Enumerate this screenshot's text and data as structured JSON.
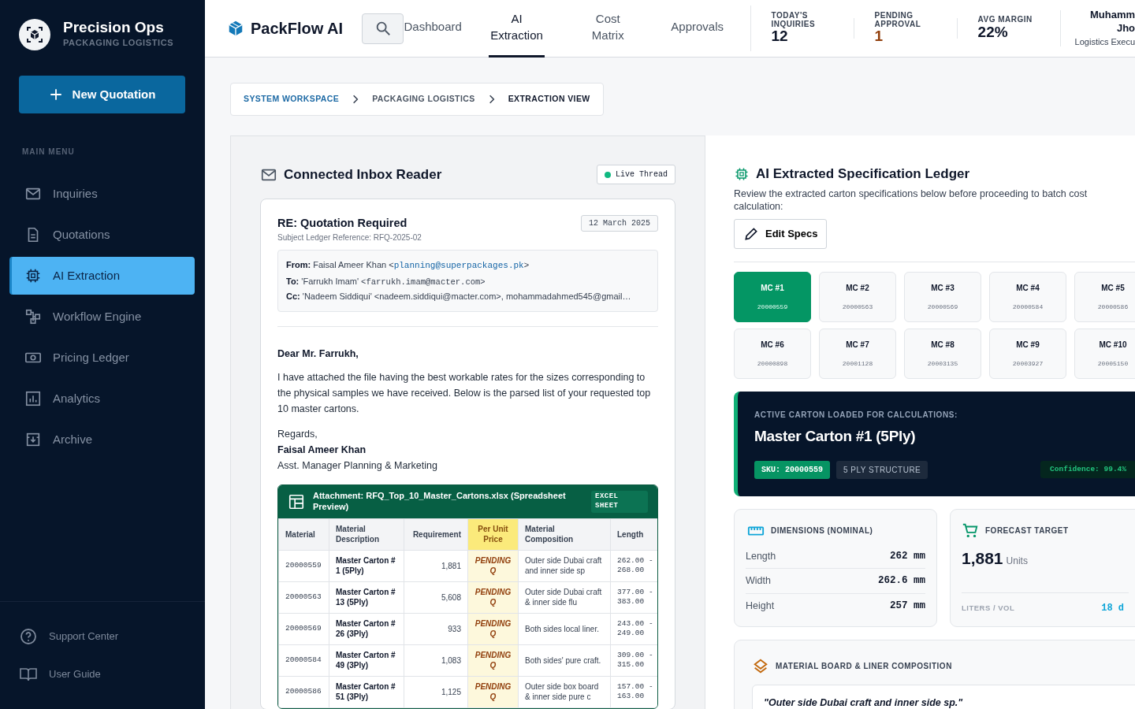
{
  "brand": {
    "title": "Precision Ops",
    "subtitle": "PACKAGING LOGISTICS"
  },
  "new_button": {
    "label": "New Quotation"
  },
  "menu_heading": "MAIN MENU",
  "sidebar": {
    "items": [
      {
        "label": "Inquiries",
        "selected": false
      },
      {
        "label": "Quotations",
        "selected": false
      },
      {
        "label": "AI Extraction",
        "selected": true
      },
      {
        "label": "Workflow Engine",
        "selected": false
      },
      {
        "label": "Pricing Ledger",
        "selected": false
      },
      {
        "label": "Analytics",
        "selected": false
      },
      {
        "label": "Archive",
        "selected": false
      }
    ],
    "footer": [
      {
        "label": "Support Center"
      },
      {
        "label": "User Guide"
      }
    ]
  },
  "header": {
    "app_title": "PackFlow AI",
    "tabs": [
      {
        "label": "Dashboard",
        "selected": false
      },
      {
        "label": "AI Extraction",
        "selected": true
      },
      {
        "label": "Cost Matrix",
        "selected": false
      },
      {
        "label": "Approvals",
        "selected": false
      }
    ],
    "stats": [
      {
        "label": "TODAY'S INQUIRIES",
        "value": "12",
        "color": "#0f172a"
      },
      {
        "label": "PENDING APPROVAL",
        "value": "1",
        "color": "#92400e"
      },
      {
        "label": "AVG MARGIN",
        "value": "22%",
        "color": "#0f172a"
      }
    ],
    "user": {
      "name": "Muhamm Jho",
      "role": "Logistics Execu"
    }
  },
  "breadcrumb": [
    {
      "label": "SYSTEM WORKSPACE",
      "selected": false
    },
    {
      "label": "PACKAGING LOGISTICS",
      "selected": false
    },
    {
      "label": "EXTRACTION VIEW",
      "selected": true
    }
  ],
  "inbox": {
    "title": "Connected Inbox Reader",
    "badge": "Live Thread",
    "email": {
      "subject": "RE: Quotation Required",
      "reference": "Subject Ledger Reference: RFQ-2025-02",
      "date": "12 March 2025",
      "headers": [
        {
          "label": "From:",
          "text": "Faisal Ameer Khan <",
          "email": "planning@superpackages.pk",
          "after": ">",
          "kind": "link"
        },
        {
          "label": "To:",
          "text": "'Farrukh Imam' ",
          "email": "<farrukh.imam@macter.com>",
          "kind": "mono"
        },
        {
          "label": "Cc:",
          "text": "'Nadeem Siddiqui' <nadeem.siddiqui@macter.com>, mohammadahmed545@gmail…",
          "kind": "plain"
        }
      ],
      "greeting": "Dear Mr. Farrukh,",
      "body": "I have attached the file having the best workable rates for the sizes corresponding to the physical samples we have received. Below is the parsed list of your requested top 10 master cartons.",
      "closing": "Regards,",
      "signer": "Faisal Ameer Khan",
      "signer_title": "Asst. Manager Planning & Marketing"
    },
    "attachment": {
      "title": "Attachment: RFQ_Top_10_Master_Cartons.xlsx (Spreadsheet Preview)",
      "badge": "EXCEL SHEET",
      "table": {
        "columns": [
          "Material",
          "Material Description",
          "Requirement",
          "Per Unit Price",
          "Material Composition",
          "Length"
        ],
        "rows": [
          [
            "20000559",
            "Master Carton # 1 (5Ply)",
            "1,881",
            "PENDING Q",
            "Outer side Dubai craft and inner side sp",
            "262.00 - 268.00"
          ],
          [
            "20000563",
            "Master Carton # 13 (5Ply)",
            "5,608",
            "PENDING Q",
            "Outer side Dubai craft & inner side flu",
            "377.00 - 383.00"
          ],
          [
            "20000569",
            "Master Carton # 26 (3Ply)",
            "933",
            "PENDING Q",
            "Both sides local liner.",
            "243.00 - 249.00"
          ],
          [
            "20000584",
            "Master Carton # 49 (3Ply)",
            "1,083",
            "PENDING Q",
            "Both sides' pure craft.",
            "309.00 - 315.00"
          ],
          [
            "20000586",
            "Master Carton # 51 (3Ply)",
            "1,125",
            "PENDING Q",
            "Outer side box board & inner side pure c",
            "157.00 - 163.00"
          ]
        ]
      }
    }
  },
  "ledger": {
    "title": "AI Extracted Specification Ledger",
    "description": "Review the extracted carton specifications below before proceeding to batch cost calculation:",
    "edit_button": "Edit Specs",
    "cartons": [
      {
        "label": "MC #1",
        "sku": "20000559",
        "selected": true
      },
      {
        "label": "MC #2",
        "sku": "20000563",
        "selected": false
      },
      {
        "label": "MC #3",
        "sku": "20000569",
        "selected": false
      },
      {
        "label": "MC #4",
        "sku": "20000584",
        "selected": false
      },
      {
        "label": "MC #5",
        "sku": "20000586",
        "selected": false
      },
      {
        "label": "MC #6",
        "sku": "20000898",
        "selected": false
      },
      {
        "label": "MC #7",
        "sku": "20001128",
        "selected": false
      },
      {
        "label": "MC #8",
        "sku": "20003135",
        "selected": false
      },
      {
        "label": "MC #9",
        "sku": "20003927",
        "selected": false
      },
      {
        "label": "MC #10",
        "sku": "20005150",
        "selected": false
      }
    ],
    "active": {
      "label": "ACTIVE CARTON LOADED FOR CALCULATIONS:",
      "title": "Master Carton #1 (5Ply)",
      "sku": "SKU: 20000559",
      "ply": "5 PLY STRUCTURE",
      "confidence": "Confidence: 99.4%"
    },
    "dimensions": {
      "title": "DIMENSIONS (NOMINAL)",
      "rows": [
        {
          "label": "Length",
          "value": "262 mm"
        },
        {
          "label": "Width",
          "value": "262.6 mm"
        },
        {
          "label": "Height",
          "value": "257 mm"
        }
      ]
    },
    "forecast": {
      "title": "FORECAST TARGET",
      "value": "1,881",
      "unit": "Units",
      "volume_label": "LITERS / VOL",
      "volume_value": "18 d"
    },
    "composition": {
      "title": "MATERIAL BOARD & LINER COMPOSITION",
      "quote": "\"Outer side Dubai craft and inner side sp.\""
    }
  }
}
